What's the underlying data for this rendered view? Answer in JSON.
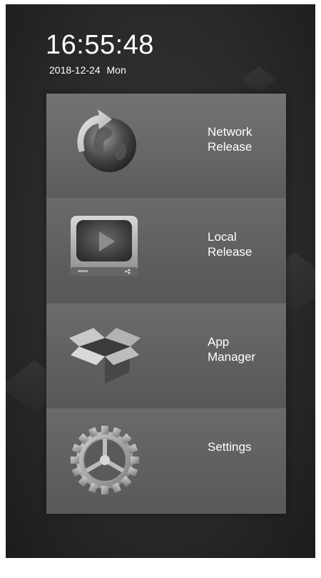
{
  "status": {
    "time": "16:55:48",
    "date": "2018-12-24",
    "weekday": "Mon"
  },
  "menu": {
    "items": [
      {
        "label": "Network\nRelease",
        "icon": "globe-refresh-icon"
      },
      {
        "label": "Local\nRelease",
        "icon": "tv-play-icon"
      },
      {
        "label": "App\nManager",
        "icon": "open-box-icon"
      },
      {
        "label": "Settings",
        "icon": "gear-icon"
      }
    ]
  }
}
